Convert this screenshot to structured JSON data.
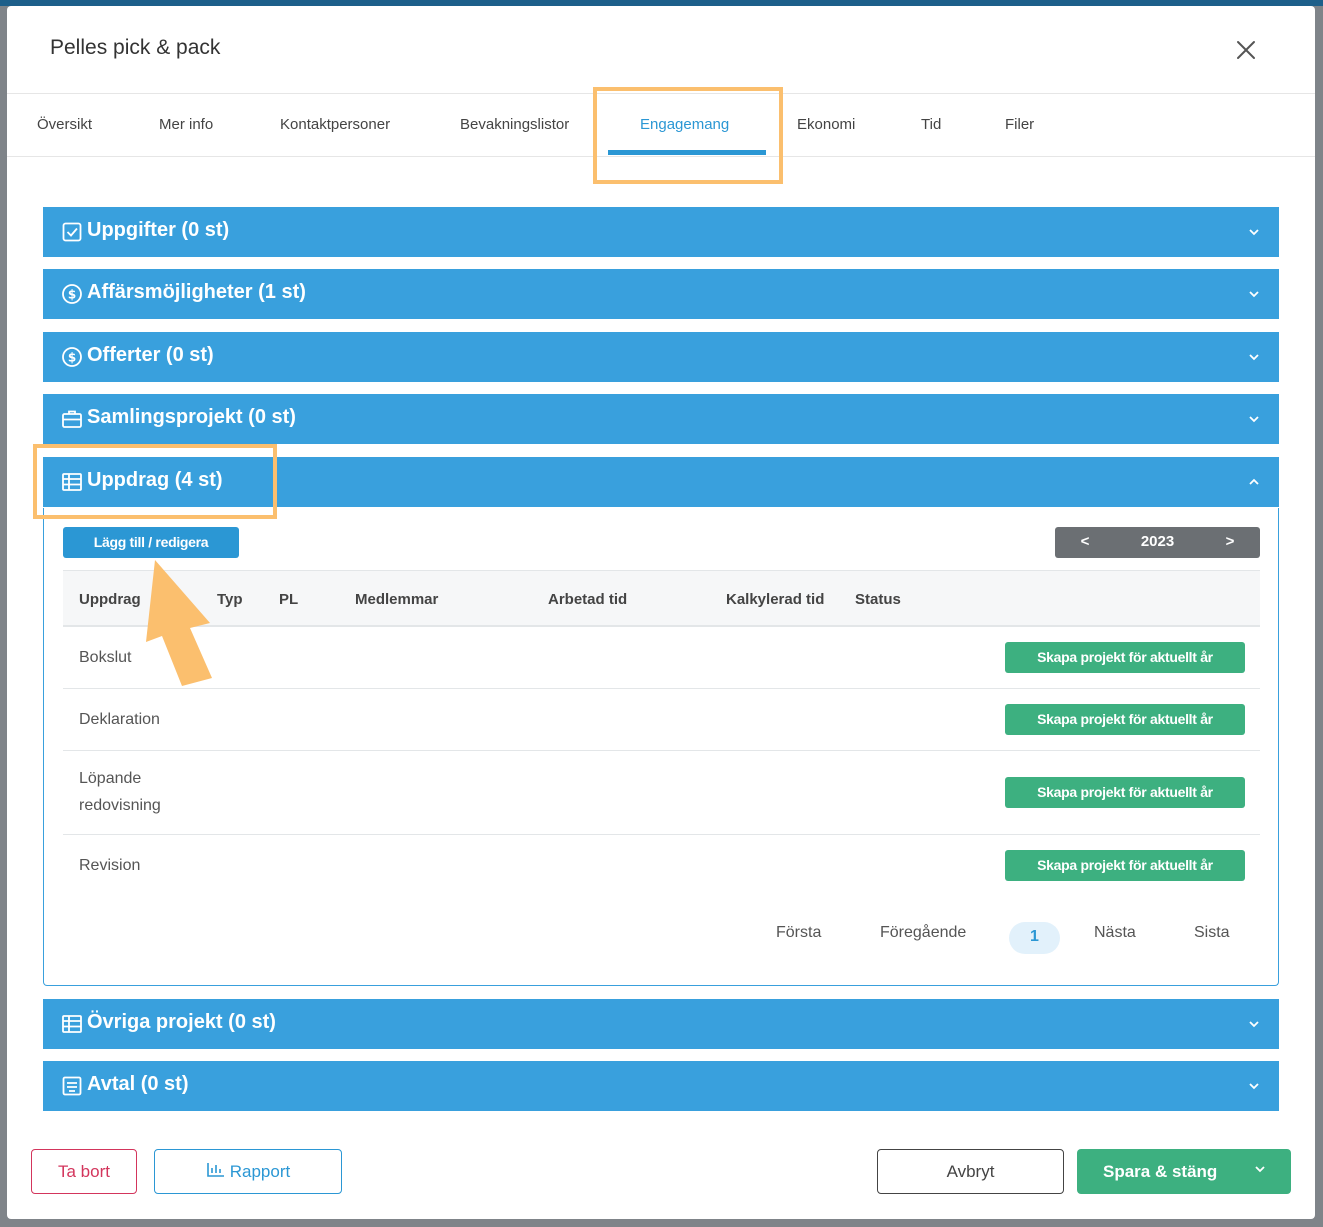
{
  "modal": {
    "title": "Pelles pick & pack"
  },
  "tabs": [
    {
      "label": "Översikt"
    },
    {
      "label": "Mer info"
    },
    {
      "label": "Kontaktpersoner"
    },
    {
      "label": "Bevakningslistor"
    },
    {
      "label": "Engagemang"
    },
    {
      "label": "Ekonomi"
    },
    {
      "label": "Tid"
    },
    {
      "label": "Filer"
    }
  ],
  "active_tab": "Engagemang",
  "sections": {
    "uppgifter": {
      "title": "Uppgifter (0 st)",
      "icon": "checkbox-icon"
    },
    "affarsmojligheter": {
      "title": "Affärsmöjligheter (1 st)",
      "icon": "dollar-circle-icon"
    },
    "offerter": {
      "title": "Offerter (0 st)",
      "icon": "dollar-circle-icon"
    },
    "samlingsprojekt": {
      "title": "Samlingsprojekt (0 st)",
      "icon": "briefcase-icon"
    },
    "uppdrag": {
      "title": "Uppdrag (4 st)",
      "icon": "table-icon"
    },
    "ovriga": {
      "title": "Övriga projekt (0 st)",
      "icon": "table-icon"
    },
    "avtal": {
      "title": "Avtal (0 st)",
      "icon": "document-icon"
    }
  },
  "uppdrag_panel": {
    "add_button": "Lägg till / redigera",
    "year": {
      "prev": "<",
      "value": "2023",
      "next": ">"
    },
    "columns": [
      "Uppdrag",
      "Typ",
      "PL",
      "Medlemmar",
      "Arbetad tid",
      "Kalkylerad tid",
      "Status"
    ],
    "rows": [
      {
        "name": "Bokslut",
        "action": "Skapa projekt för aktuellt år"
      },
      {
        "name": "Deklaration",
        "action": "Skapa projekt för aktuellt år"
      },
      {
        "name": "Löpande redovisning",
        "action": "Skapa projekt för aktuellt år"
      },
      {
        "name": "Revision",
        "action": "Skapa projekt för aktuellt år"
      }
    ],
    "pagination": {
      "first": "Första",
      "prev": "Föregående",
      "current": "1",
      "next": "Nästa",
      "last": "Sista"
    }
  },
  "footer": {
    "delete": "Ta bort",
    "report": "Rapport",
    "cancel": "Avbryt",
    "save": "Spara & stäng"
  },
  "colors": {
    "accent": "#39a0dd",
    "success": "#3db080",
    "danger": "#d3355c",
    "highlight": "#fbbf6e"
  }
}
